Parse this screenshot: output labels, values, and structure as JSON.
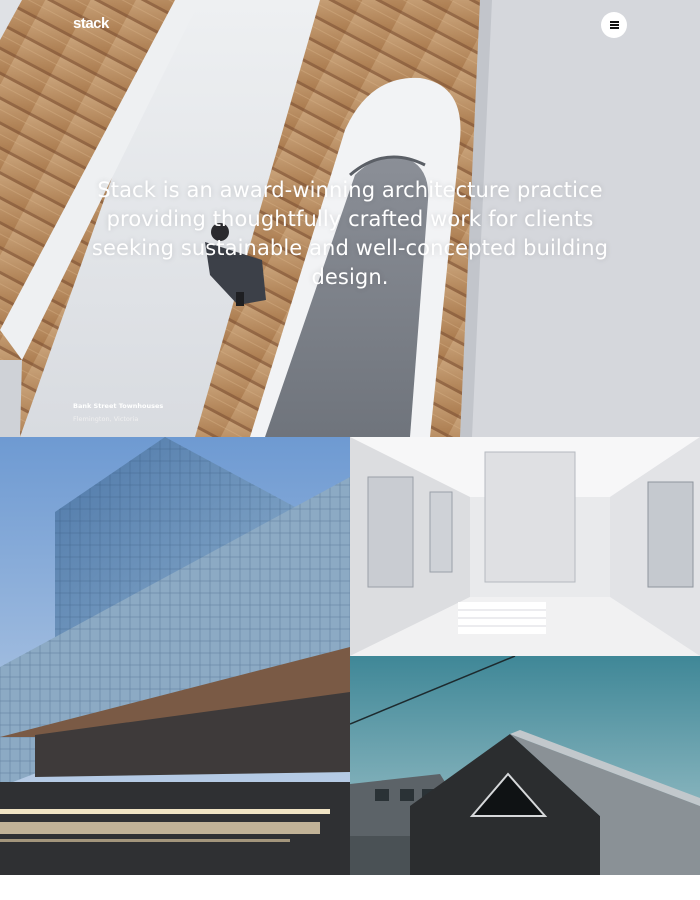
{
  "brand": {
    "logo_text": "stack"
  },
  "header": {
    "menu_icon": "hamburger-menu-icon"
  },
  "hero": {
    "tagline": "Stack is an award-winning architecture practice providing thoughtfully crafted work for clients seeking sustainable and well-concepted building design.",
    "project_title": "Bank Street Townhouses",
    "project_location": "Flemington, Victoria"
  },
  "colors": {
    "sky_teal": "#4a8f9c",
    "wood": "#b98a5c",
    "concrete": "#e4e6ea",
    "glass": "#6a8fb8"
  }
}
